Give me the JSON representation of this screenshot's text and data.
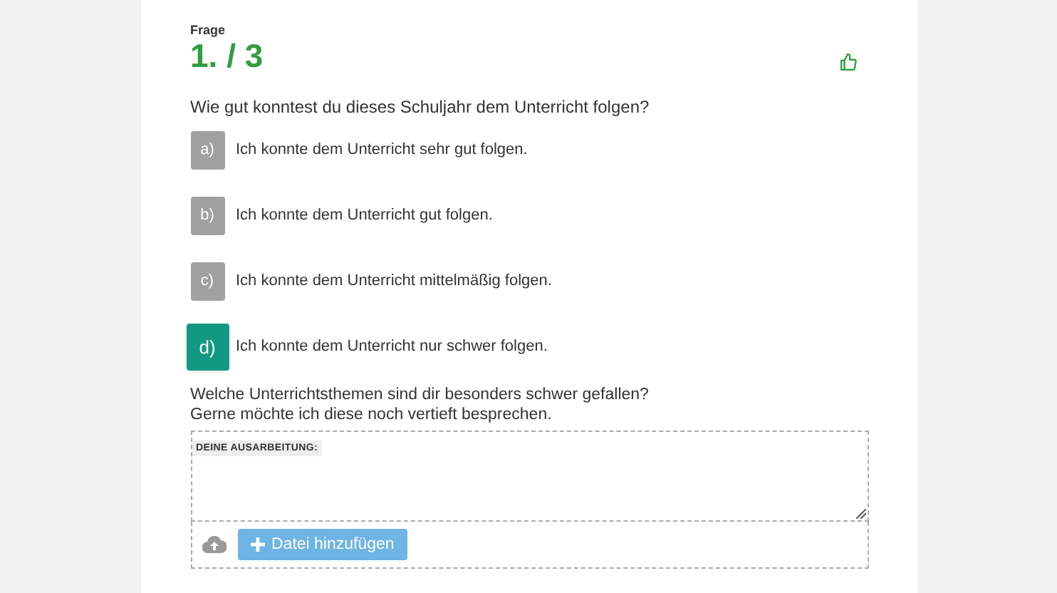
{
  "header": {
    "label": "Frage",
    "counter": "1. / 3"
  },
  "question": "Wie gut konntest du dieses Schuljahr dem Unterricht folgen?",
  "options": [
    {
      "letter": "a)",
      "text": "Ich konnte dem Unterricht sehr gut folgen.",
      "selected": false
    },
    {
      "letter": "b)",
      "text": "Ich konnte dem Unterricht gut folgen.",
      "selected": false
    },
    {
      "letter": "c)",
      "text": "Ich konnte dem Unterricht mittelmäßig folgen.",
      "selected": false
    },
    {
      "letter": "d)",
      "text": "Ich konnte dem Unterricht nur schwer folgen.",
      "selected": true
    }
  ],
  "followup": {
    "lines": [
      "Welche Unterrichtsthemen sind dir besonders schwer gefallen?",
      "Gerne möchte ich diese noch vertieft besprechen."
    ],
    "answer_label": "DEINE AUSARBEITUNG:",
    "upload_button": "Datei hinzufügen"
  }
}
